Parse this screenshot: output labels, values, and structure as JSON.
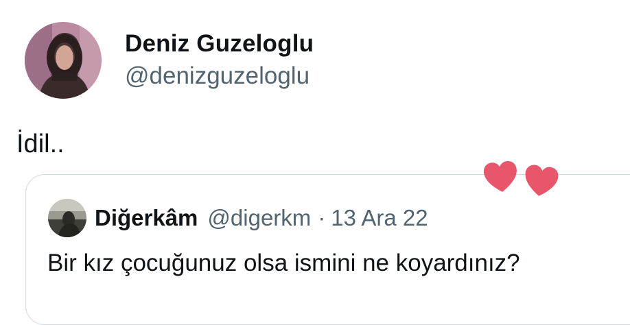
{
  "tweet": {
    "author": {
      "display_name": "Deniz Guzeloglu",
      "handle": "@denizguzeloglu"
    },
    "text": "İdil.."
  },
  "quoted_tweet": {
    "author": {
      "display_name": "Diğerkâm",
      "handle": "@digerkm"
    },
    "separator": "·",
    "date": "13 Ara 22",
    "text": "Bir kız çocuğunuz olsa ismini ne koyardınız?"
  },
  "icons": {
    "avatar": "avatar-photo",
    "quoted_avatar": "avatar-photo",
    "overlay": "heart-icon"
  },
  "colors": {
    "primary_text": "#0f1419",
    "secondary_text": "#536471",
    "card_border": "#cfd9de",
    "heart": "#e8566c"
  }
}
